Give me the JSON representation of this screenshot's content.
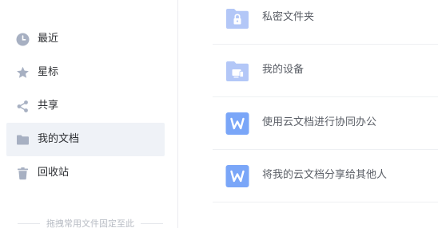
{
  "sidebar": {
    "items": [
      {
        "label": "最近",
        "icon": "clock-icon",
        "active": false
      },
      {
        "label": "星标",
        "icon": "star-icon",
        "active": false
      },
      {
        "label": "共享",
        "icon": "share-icon",
        "active": false
      },
      {
        "label": "我的文档",
        "icon": "folder-icon",
        "active": true
      },
      {
        "label": "回收站",
        "icon": "trash-icon",
        "active": false
      }
    ],
    "hint": "拖拽常用文件固定至此"
  },
  "files": [
    {
      "name": "私密文件夹",
      "icon": "lock-folder-icon"
    },
    {
      "name": "我的设备",
      "icon": "device-folder-icon"
    },
    {
      "name": "使用云文档进行协同办公",
      "icon": "word-doc-icon"
    },
    {
      "name": "将我的云文档分享给其他人",
      "icon": "word-doc-icon"
    }
  ],
  "colors": {
    "sidebar_icon": "#a7b0c2",
    "active_bg": "#eff2f7",
    "folder": "#b3c7f7",
    "folder_dark": "#9fb6f2",
    "word": "#7aa6f8"
  }
}
